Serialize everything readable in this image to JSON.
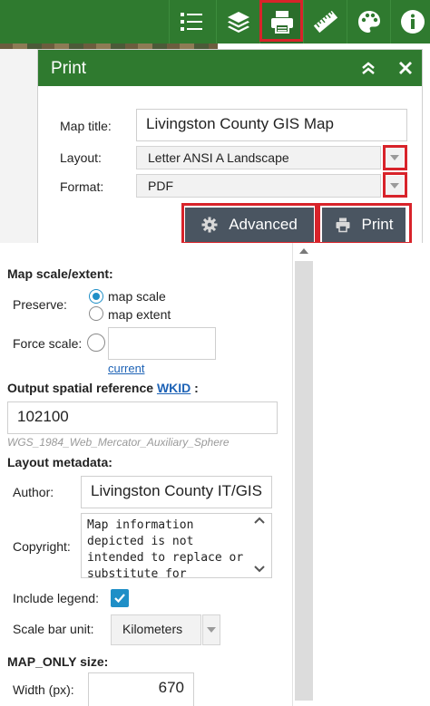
{
  "toolbar": {
    "buttons": [
      {
        "icon": "legend-list-icon",
        "active": false
      },
      {
        "icon": "layers-icon",
        "active": false
      },
      {
        "icon": "printer-icon",
        "active": true
      },
      {
        "icon": "measure-ruler-icon",
        "active": false
      },
      {
        "icon": "basemap-palette-icon",
        "active": false
      },
      {
        "icon": "info-icon",
        "active": false
      }
    ],
    "accent": "#2f7a2f",
    "highlight": "#d8232a"
  },
  "print_panel": {
    "title": "Print",
    "map_title_label": "Map title:",
    "map_title_value": "Livingston County GIS Map",
    "layout_label": "Layout:",
    "layout_value": "Letter ANSI A Landscape",
    "format_label": "Format:",
    "format_value": "PDF",
    "advanced_label": "Advanced",
    "print_label": "Print"
  },
  "advanced": {
    "map_scale_title": "Map scale/extent:",
    "preserve_label": "Preserve:",
    "preserve_options": [
      {
        "label": "map scale",
        "checked": true
      },
      {
        "label": "map extent",
        "checked": false
      }
    ],
    "force_scale_label": "Force scale:",
    "force_scale_value": "",
    "current_link": "current",
    "output_sr_title": "Output spatial reference",
    "wkid_link": "WKID",
    "output_sr_colon": ":",
    "wkid_value": "102100",
    "wkid_hint": "WGS_1984_Web_Mercator_Auxiliary_Sphere",
    "layout_metadata_title": "Layout metadata:",
    "author_label": "Author:",
    "author_value": "Livingston County IT/GIS",
    "copyright_label": "Copyright:",
    "copyright_value": "Map information depicted is not intended to replace or substitute for",
    "include_legend_label": "Include legend:",
    "include_legend_checked": true,
    "scale_bar_unit_label": "Scale bar unit:",
    "scale_bar_unit_value": "Kilometers",
    "map_only_title": "MAP_ONLY size:",
    "width_label": "Width (px):",
    "width_value": "670"
  }
}
